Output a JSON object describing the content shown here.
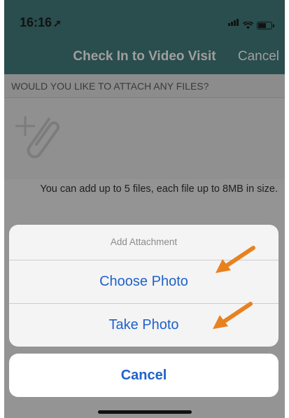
{
  "status_bar": {
    "time": "16:16",
    "location_glyph": "➚"
  },
  "nav": {
    "title": "Check In to Video Visit",
    "cancel_label": "Cancel"
  },
  "attachments": {
    "section_header": "WOULD YOU LIKE TO ATTACH ANY FILES?",
    "add_icon": "add-attachment-paperclip-icon",
    "info": "You can add up to 5 files, each file up to 8MB in size."
  },
  "action_sheet": {
    "title": "Add  Attachment",
    "options": [
      {
        "label": "Choose Photo"
      },
      {
        "label": "Take Photo"
      }
    ],
    "cancel_label": "Cancel"
  },
  "colors": {
    "header_bg": "#447c7d",
    "action_blue": "#1e62c9",
    "annotation_arrow": "#e8821e"
  }
}
